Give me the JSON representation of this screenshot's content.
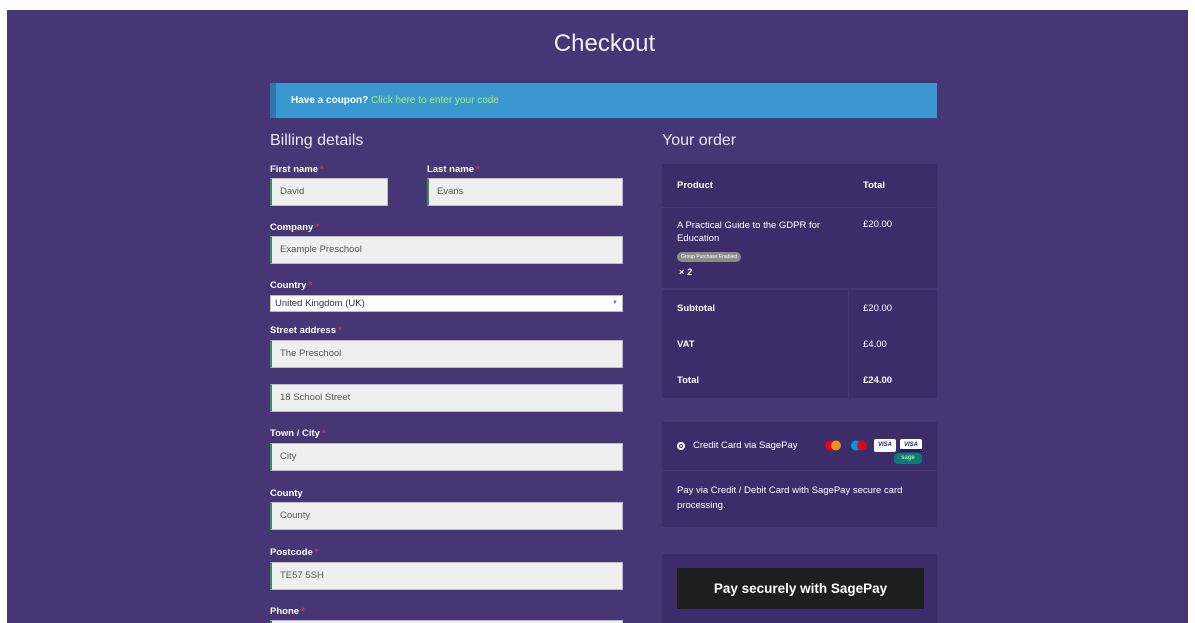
{
  "page": {
    "title": "Checkout"
  },
  "coupon": {
    "label": "Have a coupon?",
    "link": "Click here to enter your code"
  },
  "billing": {
    "heading": "Billing details",
    "required_marker": "*",
    "first_name": {
      "label": "First name",
      "value": "David"
    },
    "last_name": {
      "label": "Last name",
      "value": "Evans"
    },
    "company": {
      "label": "Company",
      "value": "Example Preschool"
    },
    "country": {
      "label": "Country",
      "value": "United Kingdom (UK)"
    },
    "street": {
      "label": "Street address",
      "line1": "The Preschool",
      "line2": "18 School Street"
    },
    "town": {
      "label": "Town / City",
      "value": "City"
    },
    "county": {
      "label": "County",
      "value": "County"
    },
    "postcode": {
      "label": "Postcode",
      "value": "TE57 5SH"
    },
    "phone": {
      "label": "Phone"
    }
  },
  "order": {
    "heading": "Your order",
    "col_product": "Product",
    "col_total": "Total",
    "item": {
      "name": "A Practical Guide to the GDPR for Education",
      "badge": "Group Purchase Enabled",
      "qty": "× 2",
      "price": "£20.00"
    },
    "subtotal_label": "Subtotal",
    "subtotal_value": "£20.00",
    "vat_label": "VAT",
    "vat_value": "£4.00",
    "total_label": "Total",
    "total_value": "£24.00"
  },
  "payment": {
    "method_label": "Credit Card via SagePay",
    "description": "Pay via Credit / Debit Card with SagePay secure card processing.",
    "card_icons": [
      "mastercard-icon",
      "maestro-icon",
      "visa-icon",
      "visa-electron-icon",
      "sage-icon"
    ],
    "card_text": {
      "visa": "VISA",
      "sage": "sage"
    },
    "button_label": "Pay securely with SagePay",
    "colors": {
      "background": "#473675",
      "panel": "#3d2c6a",
      "button": "#1e1e1e",
      "coupon_bar": "#3b97d0",
      "coupon_link": "#a7ef69",
      "required": "#d9383f"
    }
  }
}
